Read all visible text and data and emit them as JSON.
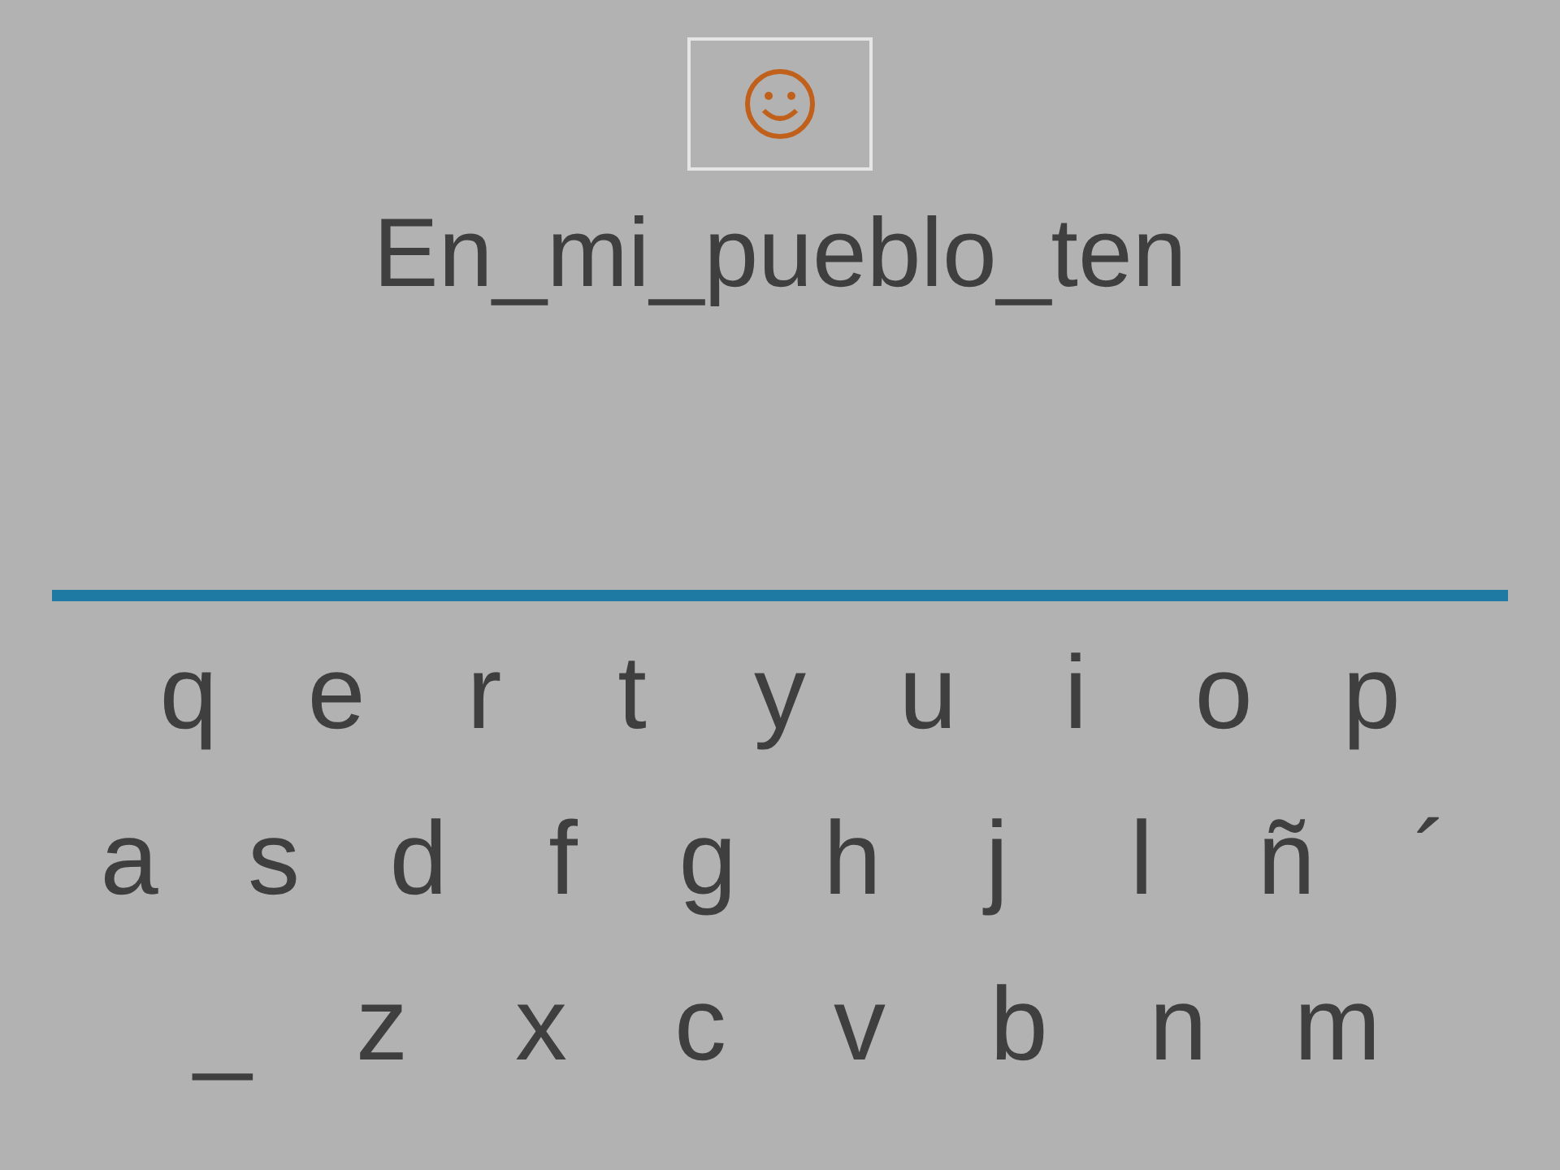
{
  "phrase": "En_mi_pueblo_ten",
  "keyboard": {
    "rows": [
      [
        "q",
        "e",
        "r",
        "t",
        "y",
        "u",
        "i",
        "o",
        "p"
      ],
      [
        "a",
        "s",
        "d",
        "f",
        "g",
        "h",
        "j",
        "l",
        "ñ",
        "´"
      ],
      [
        "_",
        "z",
        "x",
        "c",
        "v",
        "b",
        "n",
        "m"
      ]
    ]
  }
}
